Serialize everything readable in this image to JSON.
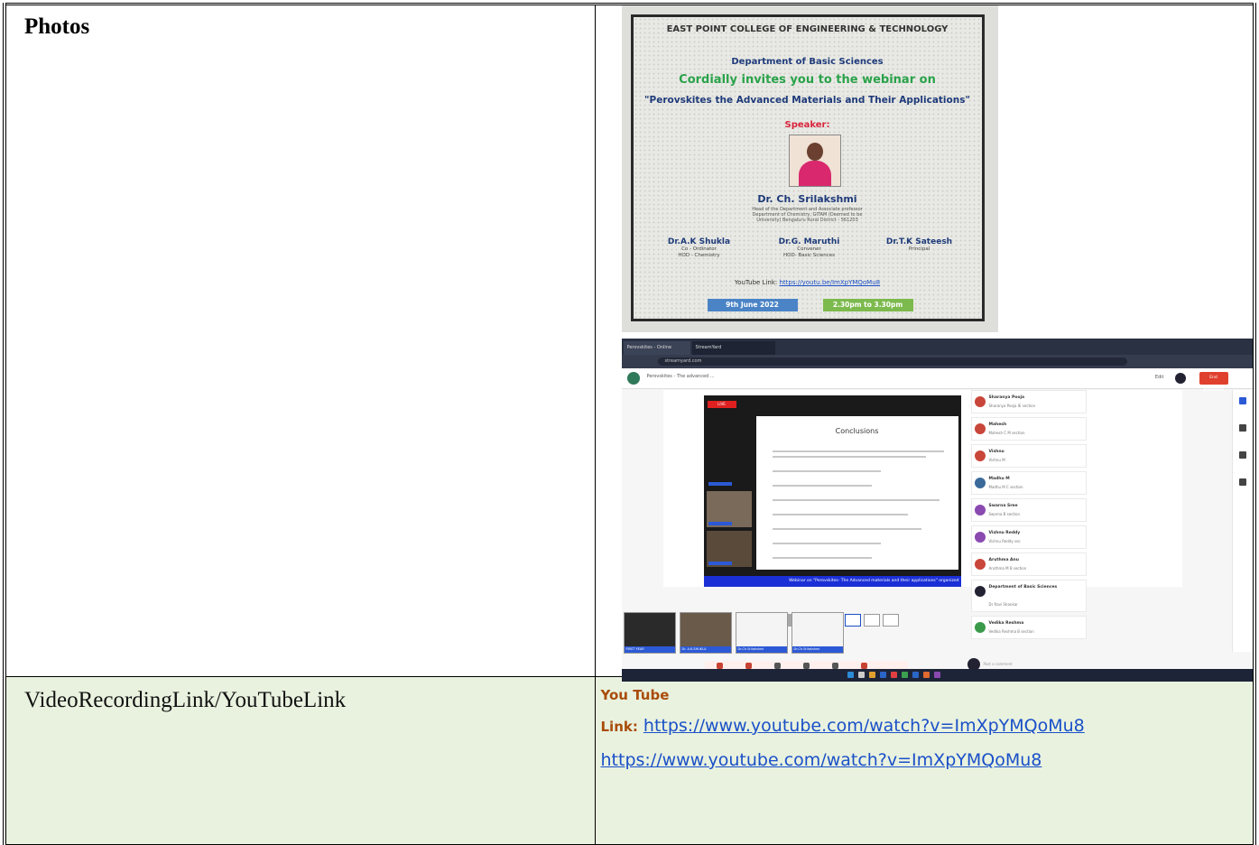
{
  "photos": {
    "label": "Photos",
    "poster": {
      "logo_text": "EAST POINT COLLEGE OF ENGINEERING & TECHNOLOGY",
      "department": "Department of Basic Sciences",
      "invite": "Cordially invites you to the webinar on",
      "topic": "\"Perovskites the Advanced Materials and Their Applications\"",
      "speaker_label": "Speaker:",
      "speaker_name": "Dr. Ch. Srilakshmi",
      "speaker_details": "Head of the Department and Associate professor Department of Chemistry, GITAM (Deemed to be University) Bengaluru Rural District - 561203",
      "people": [
        {
          "name": "Dr.A.K Shukla",
          "role": "Co - Ordinator",
          "role2": "HOD - Chemistry"
        },
        {
          "name": "Dr.G. Maruthi",
          "role": "Convener",
          "role2": "HOD- Basic Sciences"
        },
        {
          "name": "Dr.T.K Sateesh",
          "role": "Principal",
          "role2": ""
        }
      ],
      "youtube_label": "YouTube Link:",
      "youtube_url": "https://youtu.be/ImXpYMQoMu8",
      "date": "9th June 2022",
      "time": "2.30pm to 3.30pm"
    },
    "screenshot": {
      "tab1": "Perovskites - Online Meeting",
      "tab2": "StreamYard",
      "url": "streamyard.com",
      "app_title": "Perovskites - The advanced ...",
      "edit": "Edit",
      "end_button": "End broadcast",
      "live_badge": "LIVE",
      "slide_title": "Conclusions",
      "banner": "Webinar on \"Perovskites- The Advanced materials and their applications\" organized",
      "thumbs": [
        "FIRST YEAR",
        "Dr. A.K.SHUKLA",
        "Dr.Ch.Srilakshmi",
        "Dr.Ch.Srilakshmi"
      ],
      "controls": [
        "Camera",
        "Mic",
        "Settings",
        "Share",
        "Invite",
        "Leave"
      ],
      "chat": [
        {
          "name": "Sharanya Pooja",
          "text": "Sharanya Pooja IE section"
        },
        {
          "name": "Mahesh",
          "text": "Mahesh C M section"
        },
        {
          "name": "Vishnu",
          "text": "Vishnu M"
        },
        {
          "name": "Madhu M",
          "text": "Madhu M C section"
        },
        {
          "name": "Swarna Sree",
          "text": "Swarna B section"
        },
        {
          "name": "Vishnu Reddy",
          "text": "Vishnu Reddy sec"
        },
        {
          "name": "Aruthma Anu",
          "text": "Aruthma M B section"
        },
        {
          "name": "Department of Basic Sciences",
          "text": "Dr Ravi Shankar"
        },
        {
          "name": "Vedika Reshma",
          "text": "Vedika Reshma B section"
        }
      ],
      "comment_placeholder": "Post a comment"
    }
  },
  "video": {
    "label": "VideoRecordingLink/YouTubeLink",
    "title": "You Tube",
    "link_prefix": "Link:",
    "link1": "https://www.youtube.com/watch?v=ImXpYMQoMu8",
    "link2": "https://www.youtube.com/watch?v=ImXpYMQoMu8"
  }
}
